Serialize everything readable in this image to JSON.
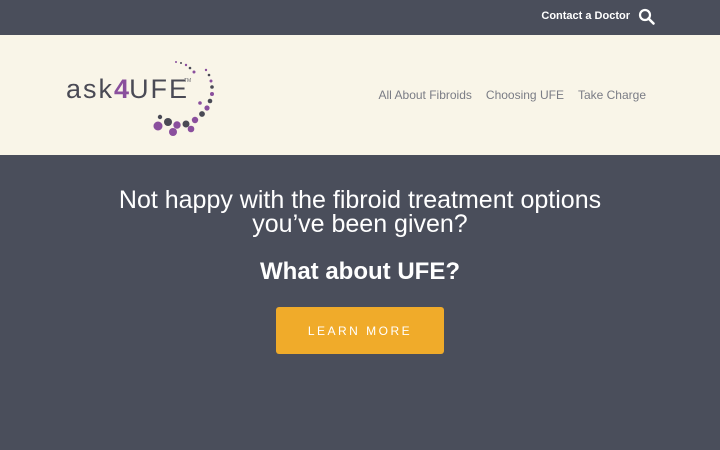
{
  "topbar": {
    "contact_label": "Contact a Doctor",
    "search_icon": "search-icon"
  },
  "logo": {
    "prefix": "ask",
    "four": "4",
    "suffix": "UFE",
    "tm": "TM",
    "accent": "#8a4f9d",
    "dark": "#4a4a55"
  },
  "nav": {
    "items": [
      {
        "label": "All About Fibroids"
      },
      {
        "label": "Choosing UFE"
      },
      {
        "label": "Take Charge"
      }
    ]
  },
  "hero": {
    "line1": "Not happy with the fibroid treatment options",
    "line2": "you’ve been given?",
    "subheading": "What about UFE?",
    "cta_label": "LEARN MORE"
  },
  "colors": {
    "topbar_bg": "#4a4e5b",
    "header_bg": "#f9f5e8",
    "hero_bg": "#4a4e5b",
    "cta_bg": "#f0ab2a",
    "nav_text": "#7a7c85"
  }
}
